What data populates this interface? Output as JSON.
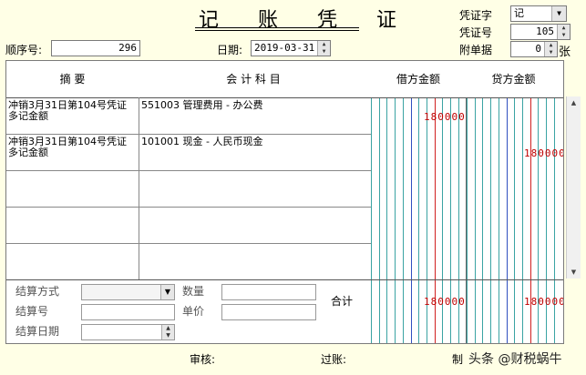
{
  "title": "记 账 凭 证",
  "header": {
    "voucher_type_label": "凭证字",
    "voucher_type_value": "记",
    "voucher_no_label": "凭证号",
    "voucher_no_value": "105",
    "attach_label": "附单据",
    "attach_value": "0",
    "attach_unit": "张",
    "seq_label": "顺序号:",
    "seq_value": "296",
    "date_label": "日期:",
    "date_value": "2019-03-31"
  },
  "columns": {
    "summary": "摘  要",
    "account": "会 计 科 目",
    "debit": "借方金额",
    "credit": "贷方金额"
  },
  "rows": [
    {
      "summary": "冲销3月31日第104号凭证\n多记金额",
      "account": "551003 管理费用 - 办公费",
      "debit": "180000",
      "credit": ""
    },
    {
      "summary": "冲销3月31日第104号凭证\n多记金额",
      "account": "101001 现金 - 人民币现金",
      "debit": "",
      "credit": "180000"
    },
    {
      "summary": "",
      "account": "",
      "debit": "",
      "credit": ""
    },
    {
      "summary": "",
      "account": "",
      "debit": "",
      "credit": ""
    },
    {
      "summary": "",
      "account": "",
      "debit": "",
      "credit": ""
    }
  ],
  "bottom": {
    "settle_method": "结算方式",
    "settle_no": "结算号",
    "settle_date": "结算日期",
    "qty": "数量",
    "price": "单价",
    "total_label": "合计",
    "total_debit": "180000",
    "total_credit": "180000"
  },
  "footer": {
    "review": "审核:",
    "post": "过账:",
    "maker": "制",
    "watermark": "头条 @财税蜗牛"
  },
  "colors": {
    "background": "#ffffe6",
    "amount_red": "#c00000",
    "grid_teal": "#3aa3a3",
    "grid_red": "#d02020",
    "grid_blue": "#3050c0"
  }
}
